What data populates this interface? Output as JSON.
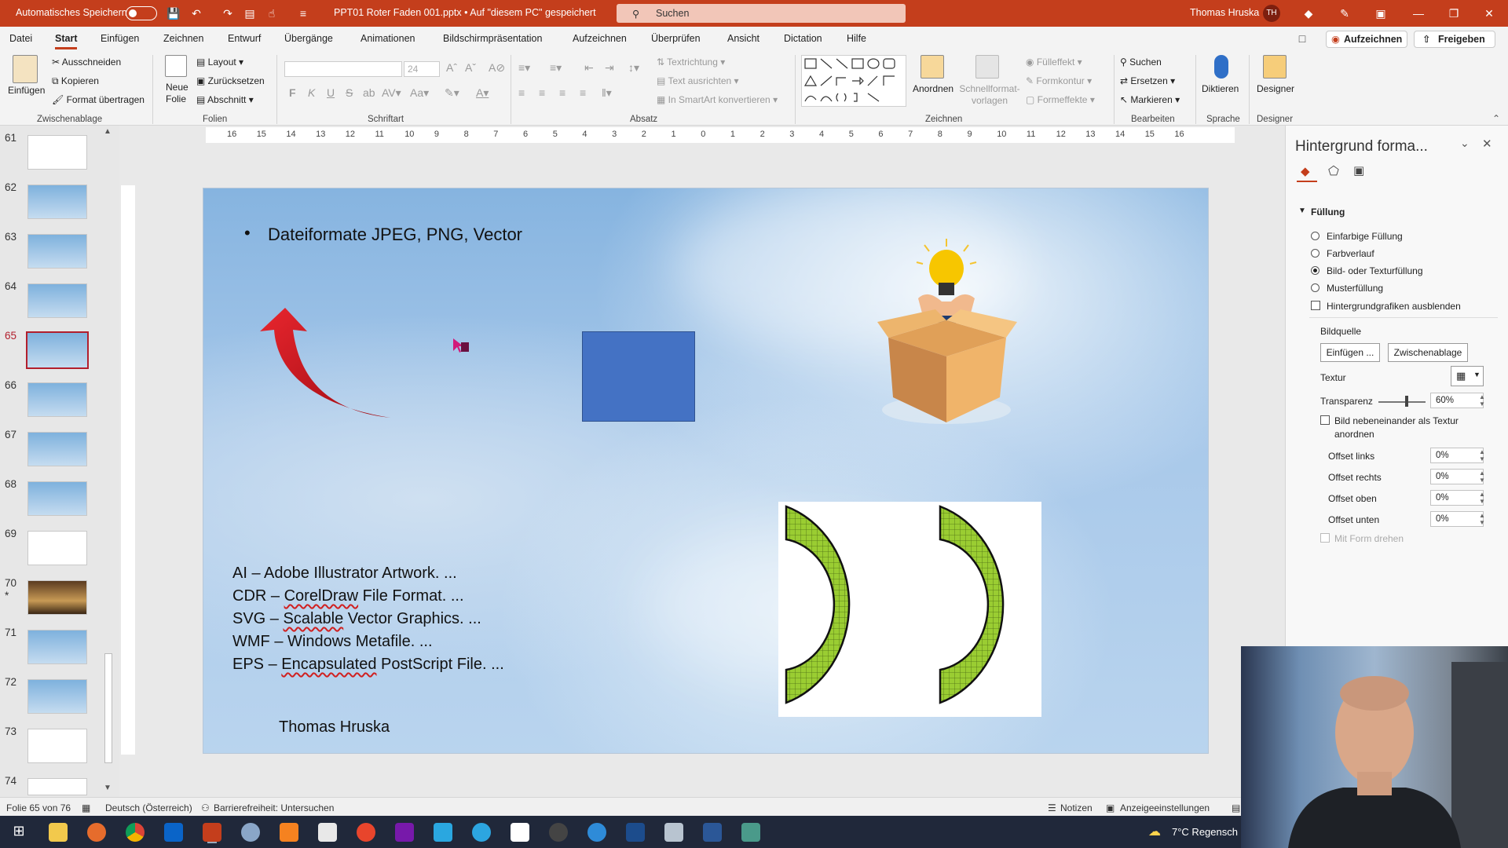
{
  "titlebar": {
    "autosave_label": "Automatisches Speichern",
    "file_title": "PPT01 Roter Faden 001.pptx  •  Auf \"diesem PC\" gespeichert",
    "search_placeholder": "Suchen",
    "user_name": "Thomas Hruska",
    "user_initials": "TH"
  },
  "menu": {
    "tabs": [
      "Datei",
      "Start",
      "Einfügen",
      "Zeichnen",
      "Entwurf",
      "Übergänge",
      "Animationen",
      "Bildschirmpräsentation",
      "Aufzeichnen",
      "Überprüfen",
      "Ansicht",
      "Dictation",
      "Hilfe"
    ],
    "active_tab": "Start",
    "record_button": "Aufzeichnen",
    "share_button": "Freigeben"
  },
  "ribbon": {
    "clipboard": {
      "paste": "Einfügen",
      "cut": "Ausschneiden",
      "copy": "Kopieren",
      "format_painter": "Format übertragen",
      "group": "Zwischenablage"
    },
    "slides": {
      "new_slide": "Neue Folie",
      "layout": "Layout",
      "reset": "Zurücksetzen",
      "section": "Abschnitt",
      "group": "Folien"
    },
    "font": {
      "size": "24",
      "bold": "F",
      "italic": "K",
      "underline": "U",
      "strike": "S",
      "group": "Schriftart"
    },
    "paragraph": {
      "text_direction": "Textrichtung",
      "align_text": "Text ausrichten",
      "smartart": "In SmartArt konvertieren",
      "group": "Absatz"
    },
    "drawing": {
      "arrange": "Anordnen",
      "quick_styles": "Schnellformat-vorlagen",
      "fill": "Fülleffekt",
      "outline": "Formkontur",
      "effects": "Formeffekte",
      "group": "Zeichnen"
    },
    "editing": {
      "find": "Suchen",
      "replace": "Ersetzen",
      "select": "Markieren",
      "group": "Bearbeiten"
    },
    "voice": {
      "dictate": "Diktieren",
      "group": "Sprache"
    },
    "designer": {
      "label": "Designer",
      "group": "Designer"
    }
  },
  "thumbnails": [
    {
      "num": "61"
    },
    {
      "num": "62"
    },
    {
      "num": "63"
    },
    {
      "num": "64"
    },
    {
      "num": "65",
      "selected": true
    },
    {
      "num": "66"
    },
    {
      "num": "67"
    },
    {
      "num": "68"
    },
    {
      "num": "69"
    },
    {
      "num": "70",
      "star": "*"
    },
    {
      "num": "71"
    },
    {
      "num": "72"
    },
    {
      "num": "73"
    },
    {
      "num": "74"
    }
  ],
  "ruler": {
    "ticks": [
      "16",
      "15",
      "14",
      "13",
      "12",
      "11",
      "10",
      "9",
      "8",
      "7",
      "6",
      "5",
      "4",
      "3",
      "2",
      "1",
      "0",
      "1",
      "2",
      "3",
      "4",
      "5",
      "6",
      "7",
      "8",
      "9",
      "10",
      "11",
      "12",
      "13",
      "14",
      "15",
      "16"
    ]
  },
  "slide": {
    "bullet": "Dateiformate JPEG, PNG, Vector",
    "formats": [
      {
        "abbr": "AI",
        "rest": " – Adobe Illustrator Artwork. ..."
      },
      {
        "abbr": "CDR",
        "pre": " – ",
        "marked": "CorelDraw",
        "rest": " File Format. ..."
      },
      {
        "abbr": "SVG",
        "pre": " – ",
        "marked": "Scalable",
        "rest": " Vector Graphics. ..."
      },
      {
        "abbr": "WMF",
        "rest": " – Windows Metafile. ..."
      },
      {
        "abbr": "EPS",
        "pre": " – ",
        "marked": "Encapsulated",
        "rest": " PostScript File. ..."
      }
    ],
    "author": "Thomas Hruska",
    "colors": {
      "arrow": "#d5121c",
      "square": "#4472c4",
      "pattern": "#9acd32"
    }
  },
  "format_pane": {
    "title": "Hintergrund forma...",
    "section": "Füllung",
    "fill_options": [
      {
        "label": "Einfarbige Füllung",
        "selected": false
      },
      {
        "label": "Farbverlauf",
        "selected": false
      },
      {
        "label": "Bild- oder Texturfüllung",
        "selected": true
      },
      {
        "label": "Musterfüllung",
        "selected": false
      }
    ],
    "hide_graphics": "Hintergrundgrafiken ausblenden",
    "image_source": "Bildquelle",
    "insert_button": "Einfügen ...",
    "clipboard_button": "Zwischenablage",
    "texture": "Textur",
    "transparency_label": "Transparenz",
    "transparency_value": "60%",
    "transparency": 0.6,
    "tile_label_1": "Bild nebeneinander als Textur",
    "tile_label_2": "anordnen",
    "offsets": [
      {
        "label": "Offset links",
        "value": "0%"
      },
      {
        "label": "Offset rechts",
        "value": "0%"
      },
      {
        "label": "Offset oben",
        "value": "0%"
      },
      {
        "label": "Offset unten",
        "value": "0%"
      }
    ],
    "rotate_with_shape": "Mit Form drehen"
  },
  "status": {
    "slide_info": "Folie 65 von 76",
    "language": "Deutsch (Österreich)",
    "accessibility": "Barrierefreiheit: Untersuchen",
    "notes": "Notizen",
    "display_settings": "Anzeigeeinstellungen"
  },
  "taskbar": {
    "weather": "7°C  Regensch"
  }
}
